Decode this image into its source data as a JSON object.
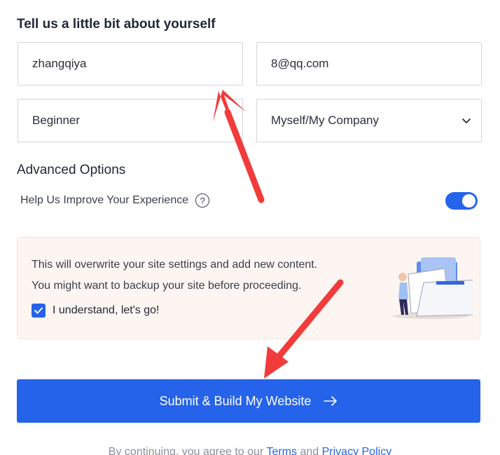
{
  "form": {
    "heading": "Tell us a little bit about yourself",
    "name_value": "zhangqiya",
    "email_value": "8@qq.com",
    "level_value": "Beginner",
    "site_for_value": "Myself/My Company"
  },
  "advanced": {
    "title": "Advanced Options",
    "improve_label": "Help Us Improve Your Experience",
    "help_icon_glyph": "?",
    "toggle_on": true
  },
  "notice": {
    "line1": "This will overwrite your site settings and add new content.",
    "line2": "You might want to backup your site before proceeding.",
    "checkbox_label": "I understand, let's go!",
    "checked": true
  },
  "submit": {
    "label": "Submit & Build My Website"
  },
  "footer": {
    "prefix": "By continuing, you agree to our",
    "terms_link": "Terms",
    "and": "and",
    "privacy_link": "Privacy Policy"
  },
  "icons": {
    "help": "help-icon",
    "chevron": "chevron-down-icon",
    "check": "check-icon",
    "arrow": "arrow-right-icon"
  },
  "colors": {
    "accent": "#2563eb",
    "notice_bg": "#fdf5f1",
    "annotation_arrow": "#f23b3b"
  }
}
